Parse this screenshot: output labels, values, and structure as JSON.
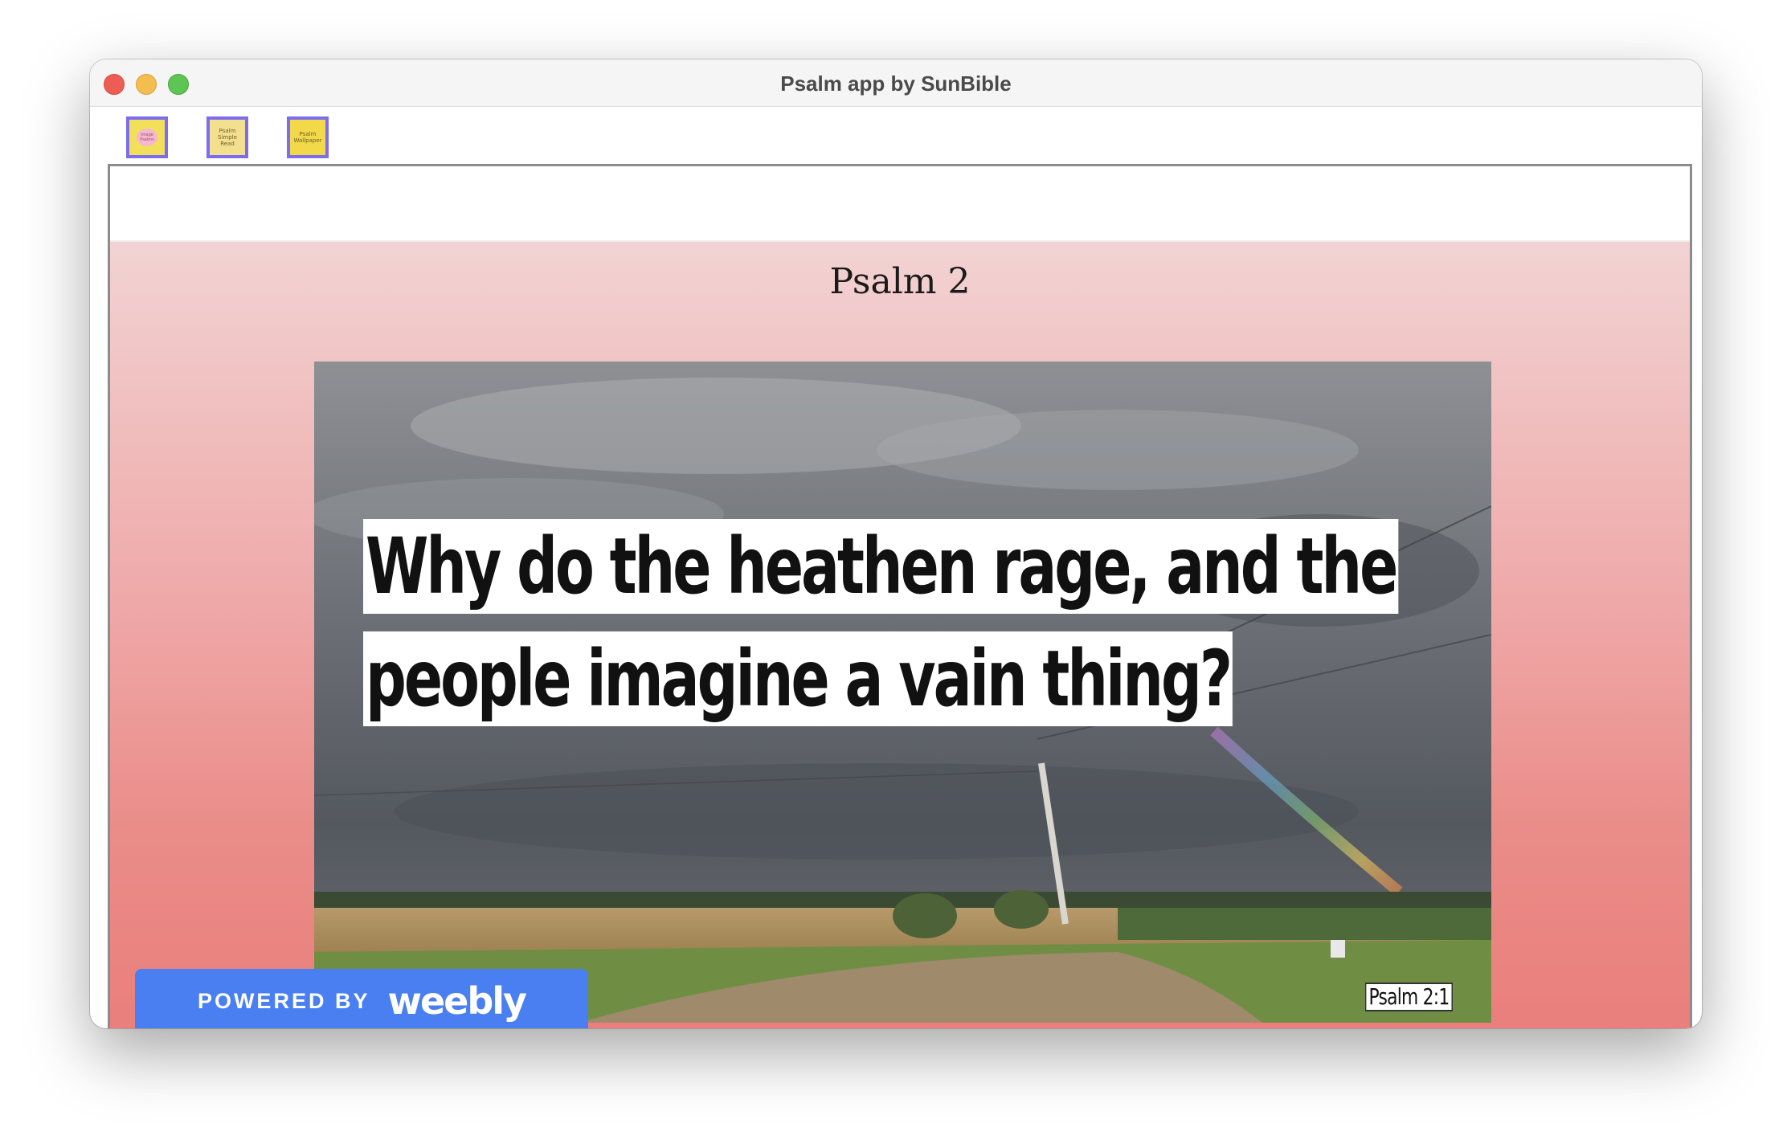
{
  "window": {
    "title": "Psalm app by SunBible"
  },
  "toolbar": {
    "items": [
      {
        "label": "Image Psalms",
        "icon": "image-psalms-icon"
      },
      {
        "label": "Psalm Simple Read",
        "icon": "simple-read-icon"
      },
      {
        "label": "Psalm Wallpaper",
        "icon": "wallpaper-icon"
      }
    ]
  },
  "page": {
    "heading": "Psalm 2",
    "image": {
      "caption_line1": "Why do the heathen rage, and the",
      "caption_line2": "people imagine a vain thing?",
      "reference": "Psalm 2:1"
    }
  },
  "badge": {
    "powered_by": "POWERED BY",
    "brand": "weebly"
  },
  "colors": {
    "badge_bg": "#4a7ff2",
    "page_gradient_top": "#f2d3d3",
    "page_gradient_bottom": "#ea7f7c",
    "toolbar_icon_border": "#7b6cf0"
  }
}
